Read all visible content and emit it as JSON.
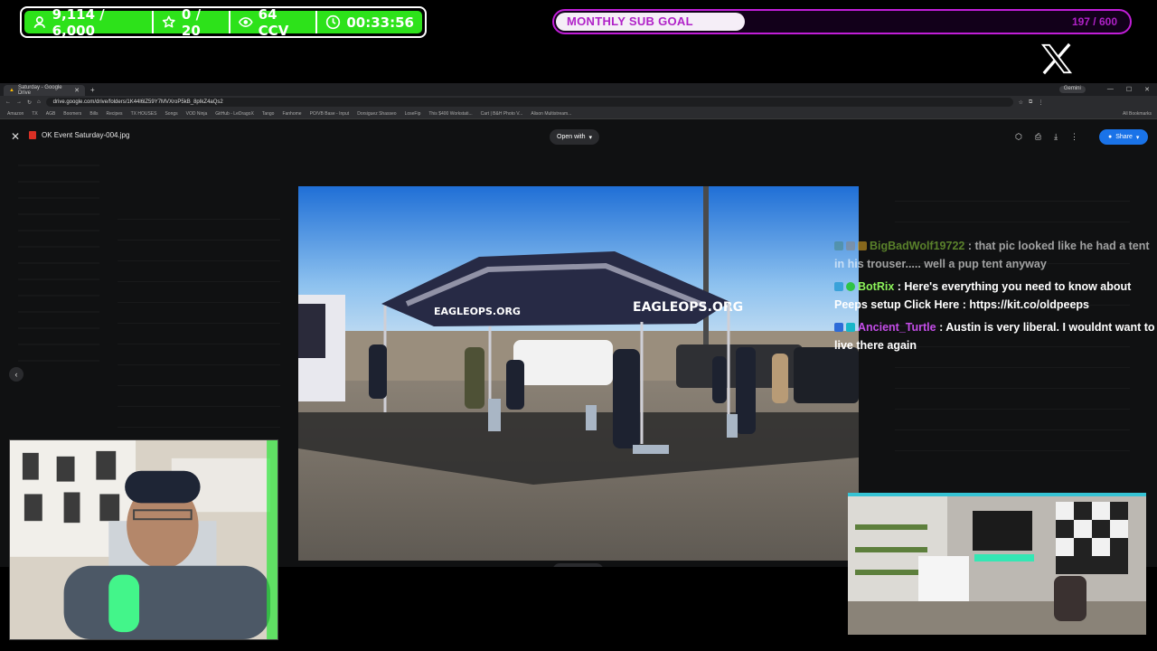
{
  "overlay": {
    "stats": [
      {
        "icon": "user-icon",
        "value": "9,114 / 6,000"
      },
      {
        "icon": "star-icon",
        "value": "0 / 20"
      },
      {
        "icon": "eye-icon",
        "value": "64 CCV"
      },
      {
        "icon": "timer-icon",
        "value": "00:33:56"
      }
    ],
    "goal": {
      "label": "MONTHLY SUB GOAL",
      "count": "197 / 600",
      "progress": 0.328
    },
    "logo": "X"
  },
  "browser": {
    "tab_title": "Saturday - Google Drive",
    "gemini_label": "Gemini",
    "url": "drive.google.com/drive/folders/1K44l6lZ59Y7MVXroP5kB_8pIkZ4aQs2",
    "bookmarks": [
      "Amazon",
      "TX",
      "AGB",
      "Boomers",
      "Bills",
      "Recipes",
      "TX HOUSES",
      "Songs",
      "VOD Ninja",
      "GitHub - LeDragoX",
      "Tango",
      "Fanhome",
      "PO/VB Base - Input",
      "Dorsiguez Shasseo",
      "LoseFip",
      "This $400 Workstati...",
      "Cart | B&H Photo V...",
      "Alison Multistream..."
    ],
    "all_bookmarks": "All Bookmarks"
  },
  "viewer": {
    "file_name": "OK Event Saturday-004.jpg",
    "open_with": "Open with",
    "share": "Share",
    "tent_text": "EAGLEOPS.ORG",
    "colors": {
      "accent": "#1a73e8",
      "file_icon": "#d93025"
    }
  },
  "chat": [
    {
      "user": "BigBadWolf19722",
      "text": "that pic looked like he had a tent in his trouser..... well a pup tent anyway",
      "color": "#8acb3a"
    },
    {
      "user": "BotRix",
      "text": "Here's everything you need to know about Peeps setup Click Here : https://kit.co/oldpeeps",
      "color": "#8cf35a"
    },
    {
      "user": "Ancient_Turtle",
      "text": "Austin is very liberal. I wouldnt want to live there again",
      "color": "#c44de8"
    }
  ]
}
